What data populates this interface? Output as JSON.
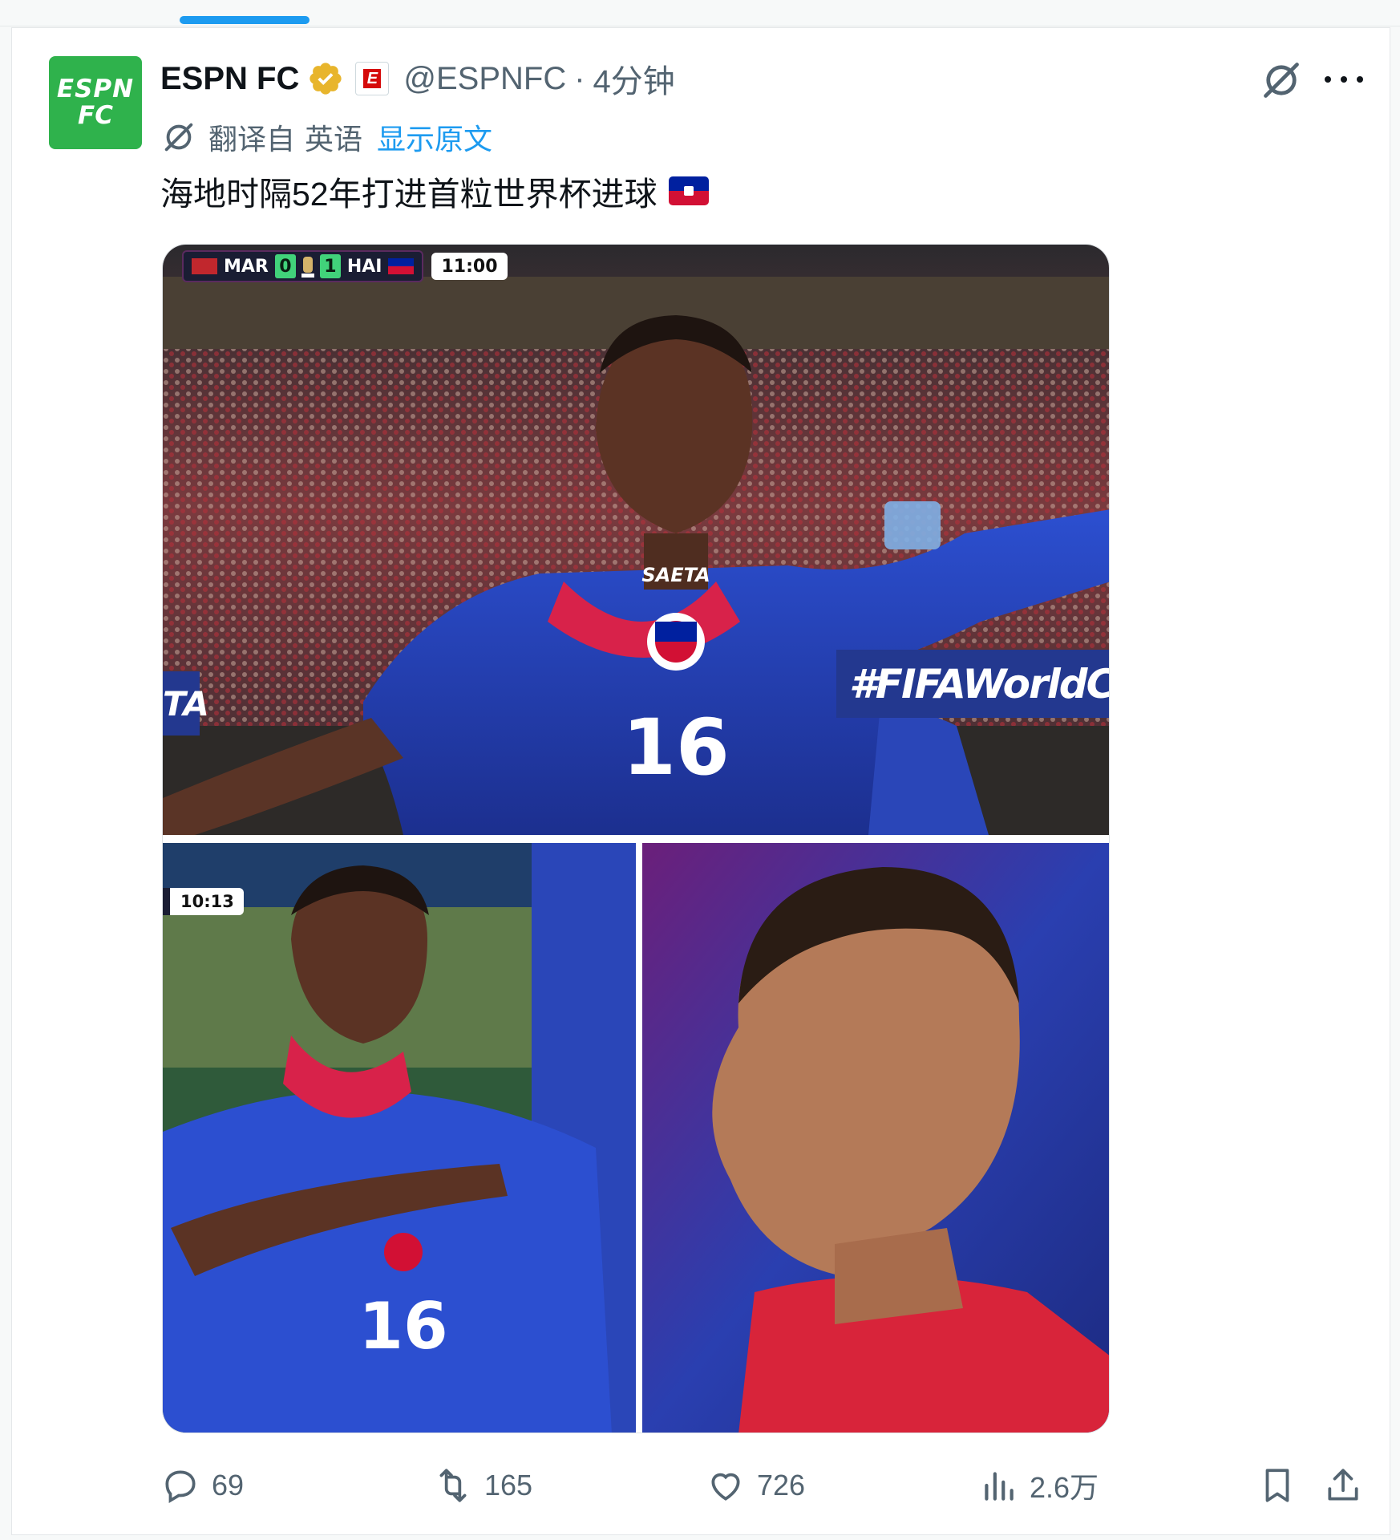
{
  "post": {
    "author_name": "ESPN FC",
    "handle": "@ESPNFC",
    "separator": "·",
    "time": "4分钟",
    "avatar_line1": "ESPN",
    "avatar_line2": "FC",
    "affiliate_badge": "E",
    "translation": {
      "label": "翻译自",
      "language": "英语",
      "show_original": "显示原文"
    },
    "text": "海地时隔52年打进首粒世界杯进球"
  },
  "media": {
    "scorebug": {
      "team_home": "MAR",
      "score_home": "0",
      "score_away": "1",
      "team_away": "HAI",
      "clock": "11:00"
    },
    "second_clock": "10:13",
    "banner_text": "#FIFAWorldCup",
    "banner_left_text": "TA",
    "jersey_number": "16",
    "jersey_sponsor": "SAETA"
  },
  "actions": {
    "replies": "69",
    "reposts": "165",
    "likes": "726",
    "views": "2.6万"
  },
  "colors": {
    "accent": "#1d9bf0",
    "avatar_bg": "#2fb24c",
    "verified_gold": "#e8b52c",
    "haiti_blue": "#00209f",
    "haiti_red": "#d21034"
  },
  "icons": [
    "verified-gold-icon",
    "grok-icon",
    "more-icon",
    "translate-icon",
    "reply-icon",
    "repost-icon",
    "like-icon",
    "views-icon",
    "bookmark-icon",
    "share-icon"
  ]
}
